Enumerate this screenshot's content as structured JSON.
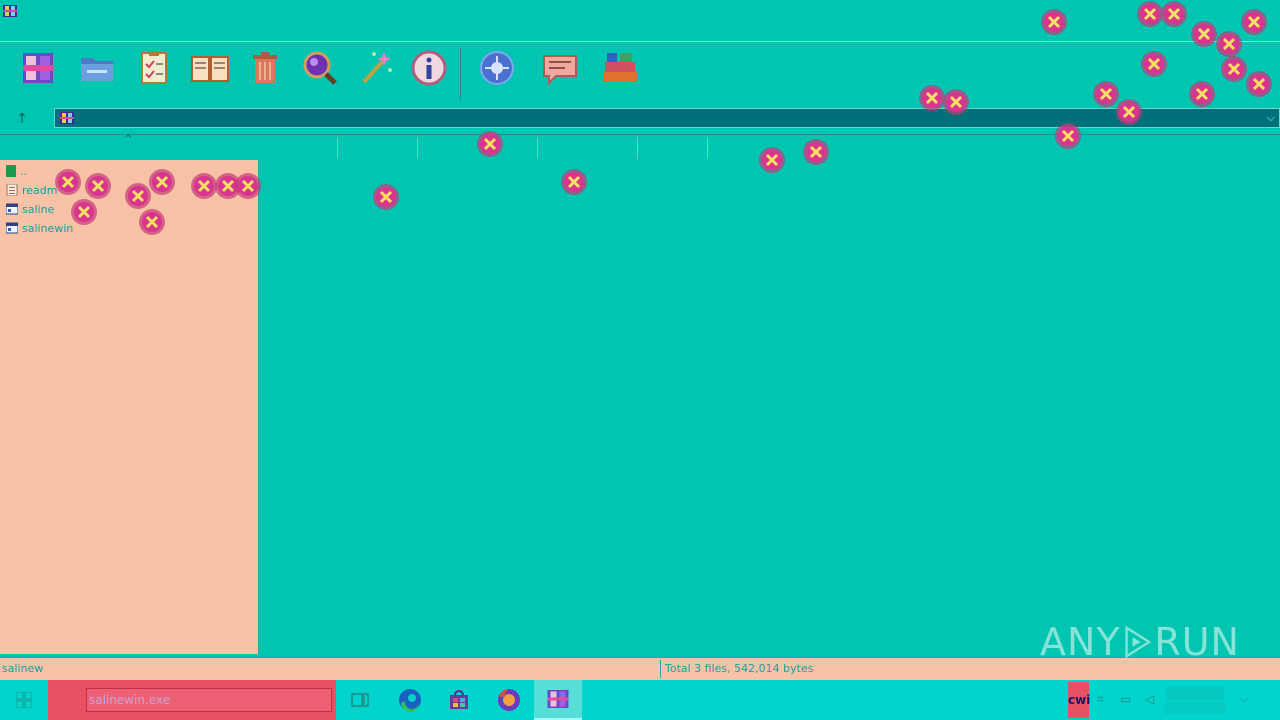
{
  "window": {
    "app_icon": "winrar-app-icon"
  },
  "toolbar": {
    "buttons": [
      {
        "id": "add",
        "icon": "archive-add-icon"
      },
      {
        "id": "extract",
        "icon": "folder-extract-icon"
      },
      {
        "id": "test",
        "icon": "clipboard-test-icon"
      },
      {
        "id": "view",
        "icon": "book-view-icon"
      },
      {
        "id": "delete",
        "icon": "trash-delete-icon"
      },
      {
        "id": "find",
        "icon": "magnifier-find-icon"
      },
      {
        "id": "wizard",
        "icon": "magic-wand-icon"
      },
      {
        "id": "info",
        "icon": "info-icon"
      },
      {
        "id": "virusscan",
        "icon": "virus-scan-icon"
      },
      {
        "id": "comment",
        "icon": "comment-icon"
      },
      {
        "id": "sfx",
        "icon": "sfx-books-icon"
      }
    ]
  },
  "address": {
    "value": ""
  },
  "tree": {
    "items": [
      {
        "label": "..",
        "icon": "folder-up-icon"
      },
      {
        "label": "readm",
        "icon": "text-file-icon"
      },
      {
        "label": "saline",
        "icon": "exe-file-icon"
      },
      {
        "label": "salinewin",
        "icon": "exe-file-icon"
      }
    ]
  },
  "status": {
    "left": "salinew",
    "right": "Total 3 files, 542,014 bytes"
  },
  "taskbar": {
    "search_text": "salinewin.exe",
    "lang": "cwi"
  },
  "watermark": {
    "left": "ANY",
    "right": "RUN"
  },
  "colors": {
    "background": "#00c5b0",
    "panel": "#f7c2a6",
    "taskbar": "#00d4cc",
    "search": "#e85064",
    "error_ring": "#c43a7a",
    "error_fill": "#d9348f"
  }
}
